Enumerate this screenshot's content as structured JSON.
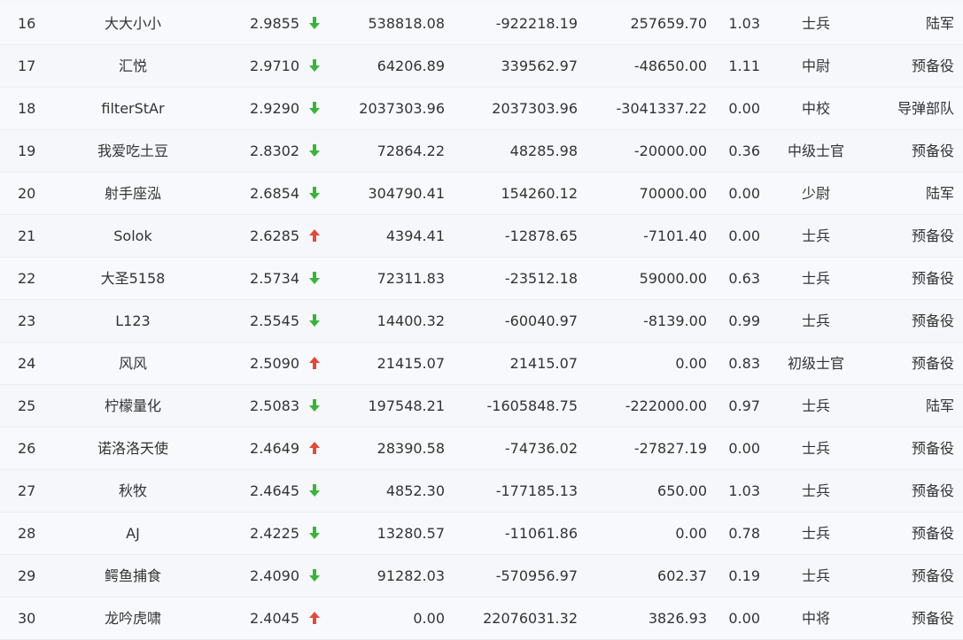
{
  "table": {
    "rows": [
      {
        "rank": "16",
        "name": "大大小小",
        "score": "2.9855",
        "trend": "down",
        "v1": "538818.08",
        "v2": "-922218.19",
        "v3": "257659.70",
        "ratio": "1.03",
        "rank_name": "士兵",
        "group": "陆军"
      },
      {
        "rank": "17",
        "name": "汇悦",
        "score": "2.9710",
        "trend": "down",
        "v1": "64206.89",
        "v2": "339562.97",
        "v3": "-48650.00",
        "ratio": "1.11",
        "rank_name": "中尉",
        "group": "预备役"
      },
      {
        "rank": "18",
        "name": "filterStAr",
        "score": "2.9290",
        "trend": "down",
        "v1": "2037303.96",
        "v2": "2037303.96",
        "v3": "-3041337.22",
        "ratio": "0.00",
        "rank_name": "中校",
        "group": "导弹部队"
      },
      {
        "rank": "19",
        "name": "我爱吃土豆",
        "score": "2.8302",
        "trend": "down",
        "v1": "72864.22",
        "v2": "48285.98",
        "v3": "-20000.00",
        "ratio": "0.36",
        "rank_name": "中级士官",
        "group": "预备役"
      },
      {
        "rank": "20",
        "name": "射手座泓",
        "score": "2.6854",
        "trend": "down",
        "v1": "304790.41",
        "v2": "154260.12",
        "v3": "70000.00",
        "ratio": "0.00",
        "rank_name": "少尉",
        "group": "陆军"
      },
      {
        "rank": "21",
        "name": "Solok",
        "score": "2.6285",
        "trend": "up",
        "v1": "4394.41",
        "v2": "-12878.65",
        "v3": "-7101.40",
        "ratio": "0.00",
        "rank_name": "士兵",
        "group": "预备役"
      },
      {
        "rank": "22",
        "name": "大圣5158",
        "score": "2.5734",
        "trend": "down",
        "v1": "72311.83",
        "v2": "-23512.18",
        "v3": "59000.00",
        "ratio": "0.63",
        "rank_name": "士兵",
        "group": "预备役"
      },
      {
        "rank": "23",
        "name": "L123",
        "score": "2.5545",
        "trend": "down",
        "v1": "14400.32",
        "v2": "-60040.97",
        "v3": "-8139.00",
        "ratio": "0.99",
        "rank_name": "士兵",
        "group": "预备役"
      },
      {
        "rank": "24",
        "name": "风风",
        "score": "2.5090",
        "trend": "up",
        "v1": "21415.07",
        "v2": "21415.07",
        "v3": "0.00",
        "ratio": "0.83",
        "rank_name": "初级士官",
        "group": "预备役"
      },
      {
        "rank": "25",
        "name": "柠檬量化",
        "score": "2.5083",
        "trend": "down",
        "v1": "197548.21",
        "v2": "-1605848.75",
        "v3": "-222000.00",
        "ratio": "0.97",
        "rank_name": "士兵",
        "group": "陆军"
      },
      {
        "rank": "26",
        "name": "诺洛洛天使",
        "score": "2.4649",
        "trend": "up",
        "v1": "28390.58",
        "v2": "-74736.02",
        "v3": "-27827.19",
        "ratio": "0.00",
        "rank_name": "士兵",
        "group": "预备役"
      },
      {
        "rank": "27",
        "name": "秋牧",
        "score": "2.4645",
        "trend": "down",
        "v1": "4852.30",
        "v2": "-177185.13",
        "v3": "650.00",
        "ratio": "1.03",
        "rank_name": "士兵",
        "group": "预备役"
      },
      {
        "rank": "28",
        "name": "AJ",
        "score": "2.4225",
        "trend": "down",
        "v1": "13280.57",
        "v2": "-11061.86",
        "v3": "0.00",
        "ratio": "0.78",
        "rank_name": "士兵",
        "group": "预备役"
      },
      {
        "rank": "29",
        "name": "鳄鱼捕食",
        "score": "2.4090",
        "trend": "down",
        "v1": "91282.03",
        "v2": "-570956.97",
        "v3": "602.37",
        "ratio": "0.19",
        "rank_name": "士兵",
        "group": "预备役"
      },
      {
        "rank": "30",
        "name": "龙吟虎啸",
        "score": "2.4045",
        "trend": "up",
        "v1": "0.00",
        "v2": "22076031.32",
        "v3": "3826.93",
        "ratio": "0.00",
        "rank_name": "中将",
        "group": "预备役"
      }
    ]
  },
  "colors": {
    "up_arrow": "#e14b3b",
    "down_arrow": "#3bb33b"
  },
  "icons": {
    "up": "arrow-up-icon",
    "down": "arrow-down-icon"
  }
}
